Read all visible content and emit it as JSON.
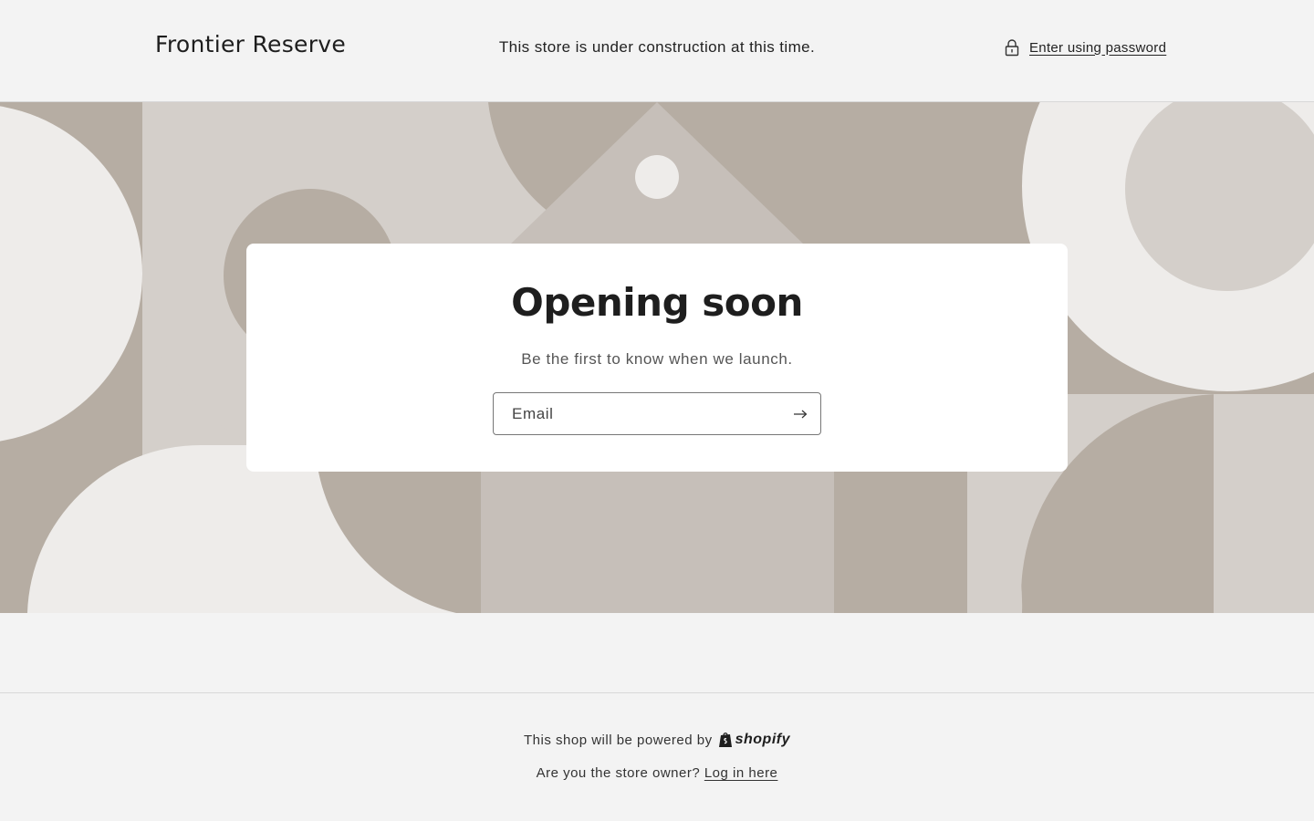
{
  "header": {
    "brand": "Frontier Reserve",
    "notice": "This store is under construction at this time.",
    "password_link": "Enter using password",
    "password_icon": "lock-icon"
  },
  "card": {
    "title": "Opening soon",
    "subtitle": "Be the first to know when we launch.",
    "email_placeholder": "Email",
    "submit_icon": "arrow-right-icon"
  },
  "footer": {
    "powered_by": "This shop will be powered by",
    "brand_logo_text": "shopify",
    "owner_prompt": "Are you the store owner?",
    "login_link": "Log in here"
  },
  "colors": {
    "page_bg": "#f3f3f3",
    "shape_dark": "#b6ada3",
    "shape_mid": "#c6bfb9",
    "shape_light": "#d4cfca",
    "shape_pale": "#eeecea"
  }
}
